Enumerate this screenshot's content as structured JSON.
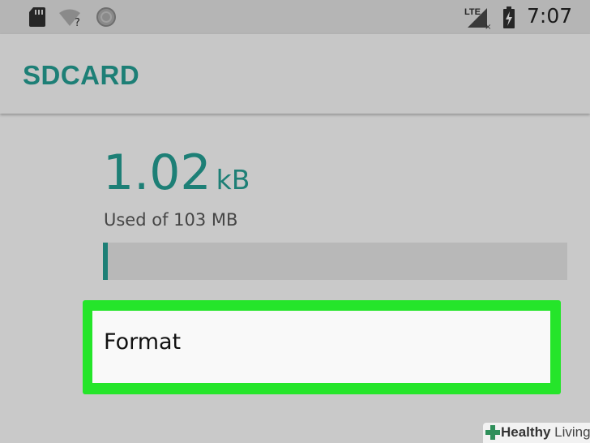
{
  "status_bar": {
    "network_label": "LTE",
    "time": "7:07",
    "icons": [
      "sd-card-icon",
      "wifi-unknown-icon",
      "sync-icon",
      "lte-signal-icon",
      "battery-charging-icon"
    ]
  },
  "app_bar": {
    "title": "SDCARD",
    "accent_color": "#1d7f76"
  },
  "storage": {
    "used_value": "1.02",
    "used_unit": "kB",
    "caption": "Used of 103 MB",
    "progress_fraction": 0.01
  },
  "actions": {
    "format_label": "Format",
    "highlight_color": "#25e52a"
  },
  "watermark": {
    "part1": "Healthy",
    "part2": " Living"
  }
}
